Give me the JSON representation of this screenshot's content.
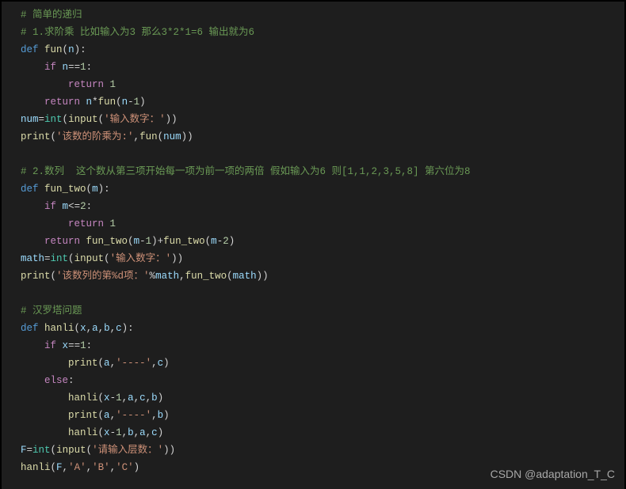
{
  "code": {
    "l1": "# 简单的递归",
    "l2": "# 1.求阶乘 比如输入为3 那么3*2*1=6 输出就为6",
    "l3_def": "def",
    "l3_fn": "fun",
    "l3_p": "n",
    "l4_if": "if",
    "l4_v": "n",
    "l4_eq": "==",
    "l4_n": "1",
    "l5_ret": "return",
    "l5_n": "1",
    "l6_ret": "return",
    "l6_v": "n",
    "l6_m": "*",
    "l6_fn": "fun",
    "l6_p": "n",
    "l6_mi": "-",
    "l6_n": "1",
    "l7_v": "num",
    "l7_eq": "=",
    "l7_int": "int",
    "l7_inp": "input",
    "l7_s": "'输入数字：'",
    "l8_fn": "print",
    "l8_s": "'该数的阶乘为:'",
    "l8_c": ",",
    "l8_fn2": "fun",
    "l8_v": "num",
    "l10": "# 2.数列  这个数从第三项开始每一项为前一项的两倍 假如输入为6 则[1,1,2,3,5,8] 第六位为8",
    "l11_def": "def",
    "l11_fn": "fun_two",
    "l11_p": "m",
    "l12_if": "if",
    "l12_v": "m",
    "l12_op": "<=",
    "l12_n": "2",
    "l13_ret": "return",
    "l13_n": "1",
    "l14_ret": "return",
    "l14_fn": "fun_two",
    "l14_v": "m",
    "l14_n1": "1",
    "l14_n2": "2",
    "l15_v": "math",
    "l15_int": "int",
    "l15_inp": "input",
    "l15_s": "'输入数字：'",
    "l16_fn": "print",
    "l16_s": "'该数列的第%d项：'",
    "l16_v1": "math",
    "l16_fn2": "fun_two",
    "l16_v2": "math",
    "l18": "# 汉罗塔问题",
    "l19_def": "def",
    "l19_fn": "hanli",
    "l19_p1": "x",
    "l19_p2": "a",
    "l19_p3": "b",
    "l19_p4": "c",
    "l20_if": "if",
    "l20_v": "x",
    "l20_eq": "==",
    "l20_n": "1",
    "l21_fn": "print",
    "l21_v1": "a",
    "l21_s": "'----'",
    "l21_v2": "c",
    "l22_else": "else",
    "l23_fn": "hanli",
    "l23_v1": "x",
    "l23_n": "1",
    "l23_v2": "a",
    "l23_v3": "c",
    "l23_v4": "b",
    "l24_fn": "print",
    "l24_v1": "a",
    "l24_s": "'----'",
    "l24_v2": "b",
    "l25_fn": "hanli",
    "l25_v1": "x",
    "l25_n": "1",
    "l25_v2": "b",
    "l25_v3": "a",
    "l25_v4": "c",
    "l26_v": "F",
    "l26_int": "int",
    "l26_inp": "input",
    "l26_s": "'请输入层数：'",
    "l27_fn": "hanli",
    "l27_v": "F",
    "l27_s1": "'A'",
    "l27_s2": "'B'",
    "l27_s3": "'C'"
  },
  "watermark": "CSDN @adaptation_T_C"
}
